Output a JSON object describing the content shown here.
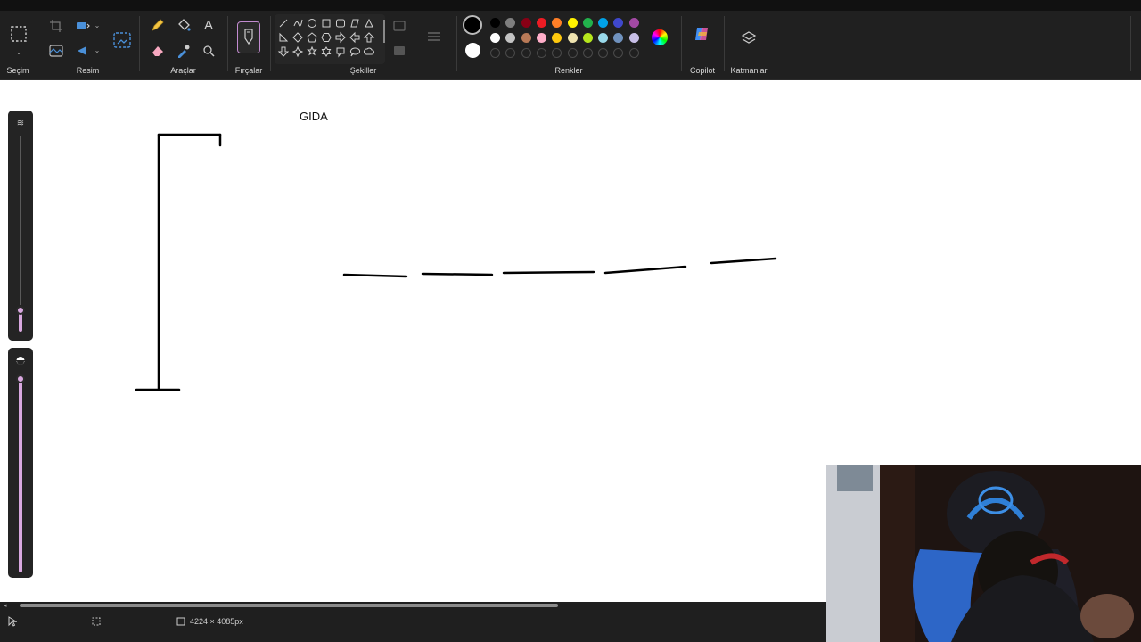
{
  "ribbon": {
    "groups": {
      "selection": "Seçim",
      "image": "Resim",
      "tools": "Araçlar",
      "brushes": "Fırçalar",
      "shapes": "Şekiller",
      "colors": "Renkler",
      "copilot": "Copilot",
      "layers": "Katmanlar"
    },
    "tool_icons": [
      "pencil-icon",
      "fill-bucket-icon",
      "text-icon",
      "eraser-icon",
      "color-picker-icon",
      "magnifier-icon"
    ],
    "shape_icons": [
      "line-icon",
      "curve-icon",
      "oval-icon",
      "rectangle-icon",
      "rounded-rectangle-icon",
      "polygon-icon",
      "triangle-icon",
      "right-triangle-icon",
      "diamond-icon",
      "pentagon-icon",
      "hexagon-icon",
      "right-arrow-icon",
      "left-arrow-icon",
      "up-arrow-icon",
      "down-arrow-icon",
      "four-point-star-icon",
      "five-point-star-icon",
      "six-point-star-icon",
      "rounded-callout-icon",
      "oval-callout-icon",
      "cloud-callout-icon"
    ],
    "colors": {
      "primary": "#000000",
      "secondary": "#ffffff",
      "row1": [
        "#000000",
        "#7f7f7f",
        "#880015",
        "#ed1c24",
        "#ff7f27",
        "#fff200",
        "#22b14c",
        "#00a2e8",
        "#3f48cc",
        "#a349a4"
      ],
      "row2": [
        "#ffffff",
        "#c3c3c3",
        "#b97a57",
        "#ffaec9",
        "#ffc90e",
        "#efe4b0",
        "#b5e61d",
        "#99d9ea",
        "#7092be",
        "#c8bfe7"
      ]
    }
  },
  "canvas": {
    "text_label": "GIDA"
  },
  "status_bar": {
    "canvas_size": "4224 × 4085px"
  }
}
